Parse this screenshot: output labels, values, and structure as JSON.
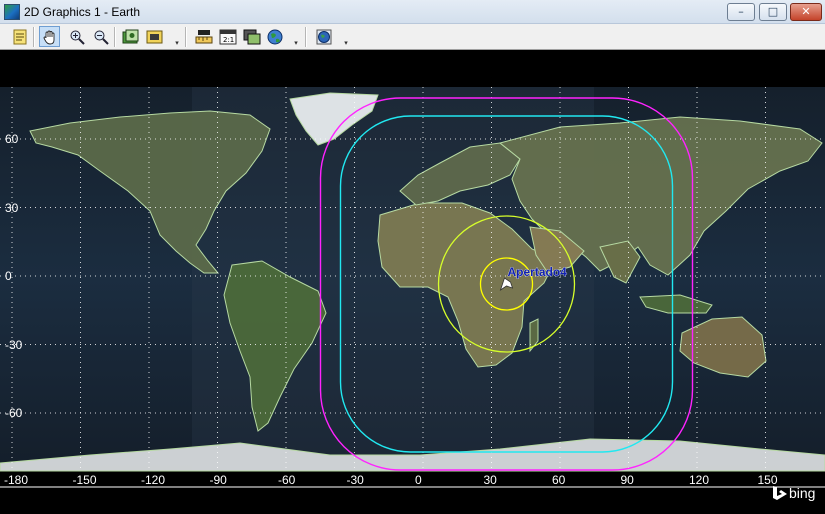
{
  "window": {
    "title": "2D Graphics 1 - Earth"
  },
  "window_controls": {
    "minimize": "–",
    "maximize": "□",
    "close": "✕"
  },
  "toolbar": {
    "icons": [
      "properties-icon",
      "pan-hand-icon",
      "zoom-in-icon",
      "zoom-out-icon",
      "snapshot-icon",
      "record-icon",
      "measure-icon",
      "aspect-ratio-icon",
      "layers-icon",
      "globe-icon",
      "3d-globe-icon"
    ],
    "dropdown_glyph": "▾"
  },
  "map": {
    "lat_labels": [
      "60",
      "30",
      "0",
      "-30",
      "-60"
    ],
    "lon_labels": [
      "-180",
      "-150",
      "-120",
      "-90",
      "-60",
      "-30",
      "0",
      "30",
      "60",
      "90",
      "120",
      "150"
    ],
    "object": {
      "name": "Apertado4",
      "lat": 0,
      "lon": 30
    },
    "coverage_colors": {
      "inner": "#ffff00",
      "outer_small": "#d7ff2b",
      "mid": "#21e8f0",
      "outer": "#ff23ff"
    },
    "grid_color": "#ffffff",
    "attribution": "bing"
  }
}
